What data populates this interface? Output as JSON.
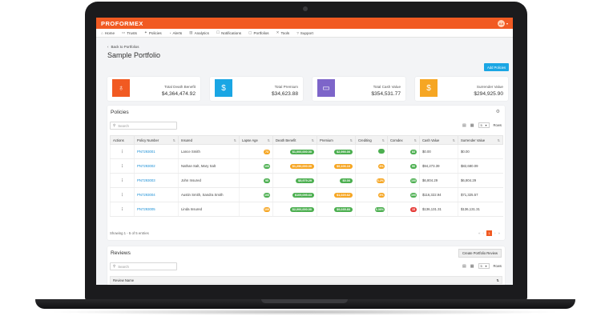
{
  "brand": "PROFORMEX",
  "user_initials": "AA",
  "nav": [
    {
      "label": "Home",
      "icon": "⌂",
      "name": "home"
    },
    {
      "label": "Trusts",
      "icon": "▭",
      "name": "trusts"
    },
    {
      "label": "Policies",
      "icon": "✦",
      "name": "policies"
    },
    {
      "label": "Alerts",
      "icon": "◔",
      "name": "alerts"
    },
    {
      "label": "Analytics",
      "icon": "▥",
      "name": "analytics"
    },
    {
      "label": "Notifications",
      "icon": "☐",
      "name": "notifications"
    },
    {
      "label": "Portfolios",
      "icon": "▢",
      "name": "portfolios"
    },
    {
      "label": "Tools",
      "icon": "✕",
      "name": "tools"
    },
    {
      "label": "Support",
      "icon": "?",
      "name": "support"
    }
  ],
  "back_label": "Back to Portfolios",
  "page_title": "Sample Portfolio",
  "add_policies_label": "Add Policies",
  "cards": [
    {
      "label": "Total Death Benefit",
      "value": "$4,364,474.92",
      "color": "#f15a22",
      "icon": "♁"
    },
    {
      "label": "Total Premium",
      "value": "$34,623.88",
      "color": "#1aa6e4",
      "icon": "$"
    },
    {
      "label": "Total Cash Value",
      "value": "$354,531.77",
      "color": "#7d65c9",
      "icon": "▭"
    },
    {
      "label": "Surrender Value",
      "value": "$294,925.90",
      "color": "#f6a623",
      "icon": "$"
    }
  ],
  "policies": {
    "title": "Policies",
    "search_placeholder": "Search",
    "rows_select": "5",
    "rows_label": "Rows",
    "columns": [
      "Actions",
      "Policy Number",
      "Insured",
      "Lapse Age",
      "Death Benefit",
      "Premium",
      "Crediting",
      "Comdex",
      "Cash Value",
      "Surrender Value"
    ],
    "rows": [
      {
        "policy": "PN7293001",
        "insured": "Lance Smith",
        "lapse": "73",
        "lapse_color": "#f6a623",
        "db": "$1,000,000.00",
        "db_color": "#4caf50",
        "premium": "$2,990.00",
        "premium_color": "#4caf50",
        "crediting": "",
        "crediting_color": "#4caf50",
        "comdex": "83",
        "comdex_color": "#4caf50",
        "cash": "$0.00",
        "surrender": "$0.00"
      },
      {
        "policy": "PN7293002",
        "insured": "Nathan Salt, Mary Salt",
        "lapse": "100",
        "lapse_color": "#4caf50",
        "db": "$1,250,000.00",
        "db_color": "#f6a623",
        "premium": "$9,106.10",
        "premium_color": "#f6a623",
        "crediting": "4%",
        "crediting_color": "#f6a623",
        "comdex": "90",
        "comdex_color": "#4caf50",
        "cash": "$94,273.39",
        "surrender": "$82,680.09"
      },
      {
        "policy": "PN7293003",
        "insured": "John Insured",
        "lapse": "95",
        "lapse_color": "#4caf50",
        "db": "$5,979.29",
        "db_color": "#4caf50",
        "premium": "$0.00",
        "premium_color": "#4caf50",
        "crediting": "6.2%",
        "crediting_color": "#f6a623",
        "comdex": "100",
        "comdex_color": "#4caf50",
        "cash": "$6,804.29",
        "surrender": "$6,804.29"
      },
      {
        "policy": "PN7293004",
        "insured": "Austin Smith, Sandra Smith",
        "lapse": "100",
        "lapse_color": "#4caf50",
        "db": "$109,095.63",
        "db_color": "#4caf50",
        "premium": "$1,020.62",
        "premium_color": "#f6a623",
        "crediting": "4%",
        "crediting_color": "#f6a623",
        "comdex": "100",
        "comdex_color": "#4caf50",
        "cash": "$116,322.94",
        "surrender": "$71,325.57"
      },
      {
        "policy": "PN7293005",
        "insured": "Linda Insured",
        "lapse": "100",
        "lapse_color": "#f6a623",
        "db": "$2,000,000.00",
        "db_color": "#4caf50",
        "premium": "$9,035.83",
        "premium_color": "#4caf50",
        "crediting": "6.36%",
        "crediting_color": "#4caf50",
        "comdex": "15",
        "comdex_color": "#e53935",
        "cash": "$136,131.31",
        "surrender": "$136,131.31"
      }
    ],
    "footer": "Showing 1 - 5 of 5 entries",
    "current_page": "1"
  },
  "reviews": {
    "title": "Reviews",
    "create_label": "Create Portfolio Review",
    "search_placeholder": "Search",
    "rows_select": "5",
    "rows_label": "Rows",
    "column": "Review Name"
  }
}
